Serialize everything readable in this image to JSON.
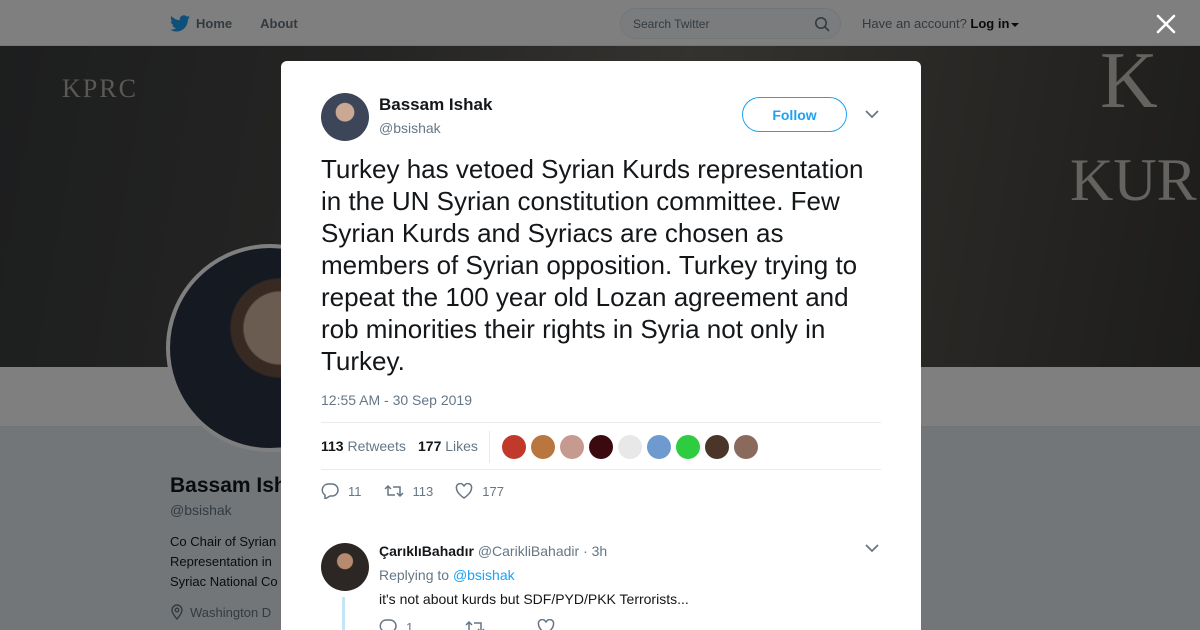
{
  "topbar": {
    "nav": [
      {
        "label": "Home",
        "icon": "twitter-bird-icon"
      },
      {
        "label": "About"
      }
    ],
    "search_placeholder": "Search Twitter",
    "account_prompt": "Have an account?",
    "login_label": "Log in"
  },
  "banner": {
    "text_left": "KPRC",
    "text_right_top": "K",
    "text_right": "KUR"
  },
  "profile": {
    "name": "Bassam Ish",
    "handle": "@bsishak",
    "bio_lines": [
      "Co Chair of Syrian",
      "Representation in",
      "Syriac National Co"
    ],
    "location": "Washington D"
  },
  "tweet": {
    "author_name": "Bassam Ishak",
    "author_handle": "@bsishak",
    "follow_label": "Follow",
    "text": "Turkey has vetoed Syrian Kurds representation in the UN Syrian constitution committee. Few Syrian Kurds and Syriacs are chosen as members of Syrian opposition. Turkey trying to repeat the 100 year old Lozan agreement and rob minorities their rights in Syria not only in Turkey.",
    "timestamp": "12:55 AM - 30 Sep 2019",
    "retweets_count": "113",
    "retweets_label": "Retweets",
    "likes_count": "177",
    "likes_label": "Likes",
    "actions": {
      "replies": "11",
      "retweets": "113",
      "likes": "177"
    }
  },
  "likers_colors": [
    "#c0392b",
    "#b9773f",
    "#c79a8f",
    "#3a0a0f",
    "#e8e8e8",
    "#6f9ad0",
    "#2ecc40",
    "#4a3528",
    "#8a6a5d"
  ],
  "reply": {
    "name": "ÇarıklıBahadır",
    "handle": "@CarikliBahadir",
    "dot": "·",
    "time": "3h",
    "replying_prefix": "Replying to",
    "replying_to": "@bsishak",
    "text": "it's not about kurds but SDF/PYD/PKK Terrorists...",
    "reply_count": "1"
  },
  "colors": {
    "brand": "#1da1f2",
    "secondary_text": "#657786"
  }
}
